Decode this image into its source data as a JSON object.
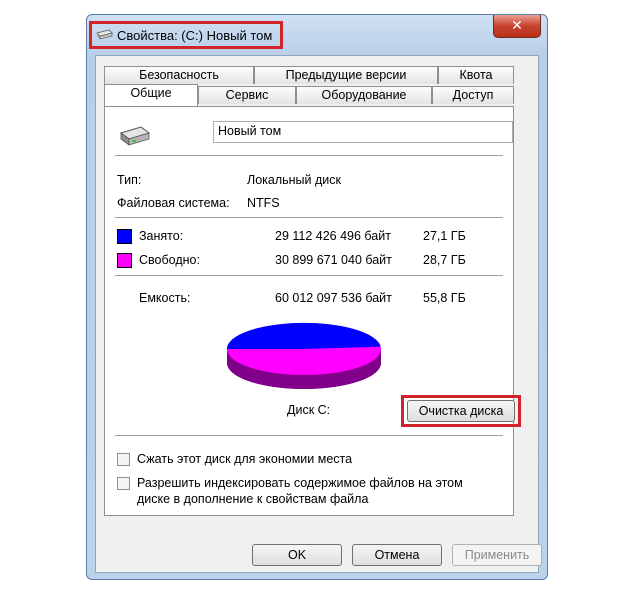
{
  "window": {
    "title": "Свойства: (C:) Новый том",
    "close_glyph": "✕"
  },
  "tabs_back": [
    "Безопасность",
    "Предыдущие версии",
    "Квота"
  ],
  "tabs_front": [
    "Общие",
    "Сервис",
    "Оборудование",
    "Доступ"
  ],
  "general": {
    "volume_name": "Новый том",
    "type_label": "Тип:",
    "type_value": "Локальный диск",
    "fs_label": "Файловая система:",
    "fs_value": "NTFS",
    "used_label": "Занято:",
    "used_bytes": "29 112 426 496 байт",
    "used_size": "27,1 ГБ",
    "free_label": "Свободно:",
    "free_bytes": "30 899 671 040 байт",
    "free_size": "28,7 ГБ",
    "capacity_label": "Емкость:",
    "capacity_bytes": "60 012 097 536 байт",
    "capacity_size": "55,8 ГБ",
    "disk_label": "Диск C:",
    "cleanup_button": "Очистка диска",
    "compress_label": "Сжать этот диск для экономии места",
    "index_label_1": "Разрешить индексировать содержимое файлов на этом",
    "index_label_2": "диске в дополнение к свойствам файла",
    "used_fraction": 0.485
  },
  "colors": {
    "used": "#0000ff",
    "free": "#ff00ff"
  },
  "buttons": {
    "ok": "OK",
    "cancel": "Отмена",
    "apply": "Применить"
  }
}
